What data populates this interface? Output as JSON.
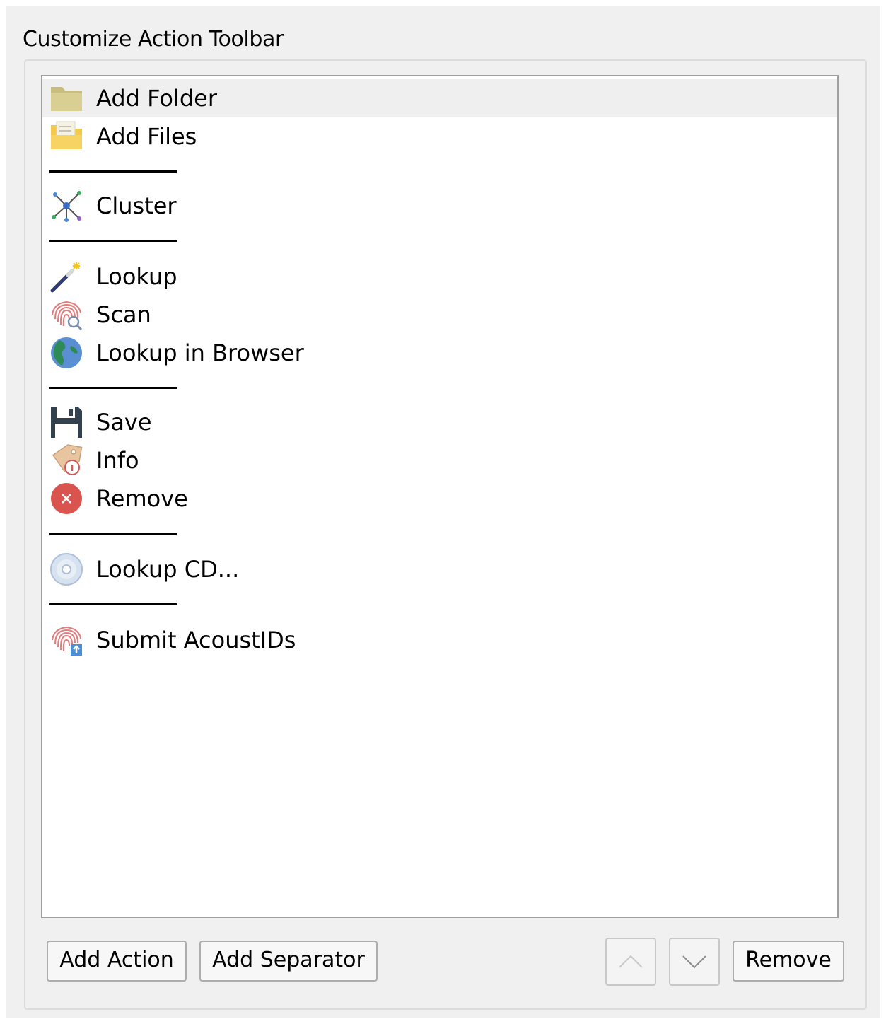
{
  "group_title": "Customize Action Toolbar",
  "items": [
    {
      "label": "Add Folder",
      "icon": "folder-icon",
      "selected": true
    },
    {
      "label": "Add Files",
      "icon": "add-files-icon"
    },
    {
      "separator": true
    },
    {
      "label": "Cluster",
      "icon": "cluster-icon"
    },
    {
      "separator": true
    },
    {
      "label": "Lookup",
      "icon": "magic-wand-icon"
    },
    {
      "label": "Scan",
      "icon": "fingerprint-scan-icon"
    },
    {
      "label": "Lookup in Browser",
      "icon": "globe-icon"
    },
    {
      "separator": true
    },
    {
      "label": "Save",
      "icon": "floppy-disk-icon"
    },
    {
      "label": "Info",
      "icon": "tag-icon"
    },
    {
      "label": "Remove",
      "icon": "remove-circle-icon"
    },
    {
      "separator": true
    },
    {
      "label": "Lookup CD...",
      "icon": "cd-icon"
    },
    {
      "separator": true
    },
    {
      "label": "Submit AcoustIDs",
      "icon": "fingerprint-submit-icon"
    }
  ],
  "buttons": {
    "add_action": "Add Action",
    "add_separator": "Add Separator",
    "move_up_icon": "chevron-up-icon",
    "move_down_icon": "chevron-down-icon",
    "remove": "Remove"
  }
}
